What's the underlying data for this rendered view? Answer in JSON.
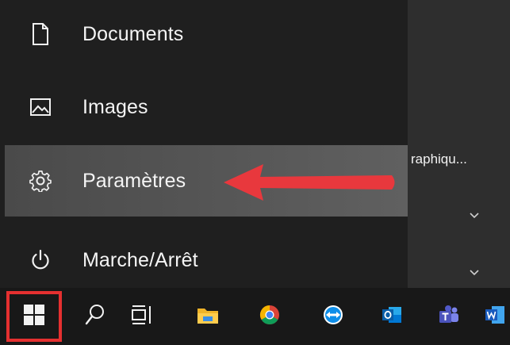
{
  "menu": {
    "items": [
      {
        "id": "documents",
        "label": "Documents",
        "icon": "document-icon"
      },
      {
        "id": "images",
        "label": "Images",
        "icon": "image-icon"
      },
      {
        "id": "settings",
        "label": "Paramètres",
        "icon": "gear-icon"
      },
      {
        "id": "power",
        "label": "Marche/Arrêt",
        "icon": "power-icon"
      }
    ]
  },
  "background": {
    "partial_text": "raphiqu..."
  },
  "taskbar": {
    "apps": [
      {
        "id": "start",
        "icon": "windows-logo-icon"
      },
      {
        "id": "search",
        "icon": "search-icon"
      },
      {
        "id": "taskview",
        "icon": "task-view-icon"
      },
      {
        "id": "explorer",
        "icon": "file-explorer-icon"
      },
      {
        "id": "chrome",
        "icon": "chrome-icon"
      },
      {
        "id": "teamviewer",
        "icon": "teamviewer-icon"
      },
      {
        "id": "outlook",
        "icon": "outlook-icon"
      },
      {
        "id": "teams",
        "icon": "teams-icon"
      },
      {
        "id": "word",
        "icon": "word-icon"
      }
    ]
  },
  "colors": {
    "highlight": "#e53030",
    "menu_bg": "#1f1f1f",
    "taskbar_bg": "#181818",
    "text": "#f4f4f4"
  }
}
